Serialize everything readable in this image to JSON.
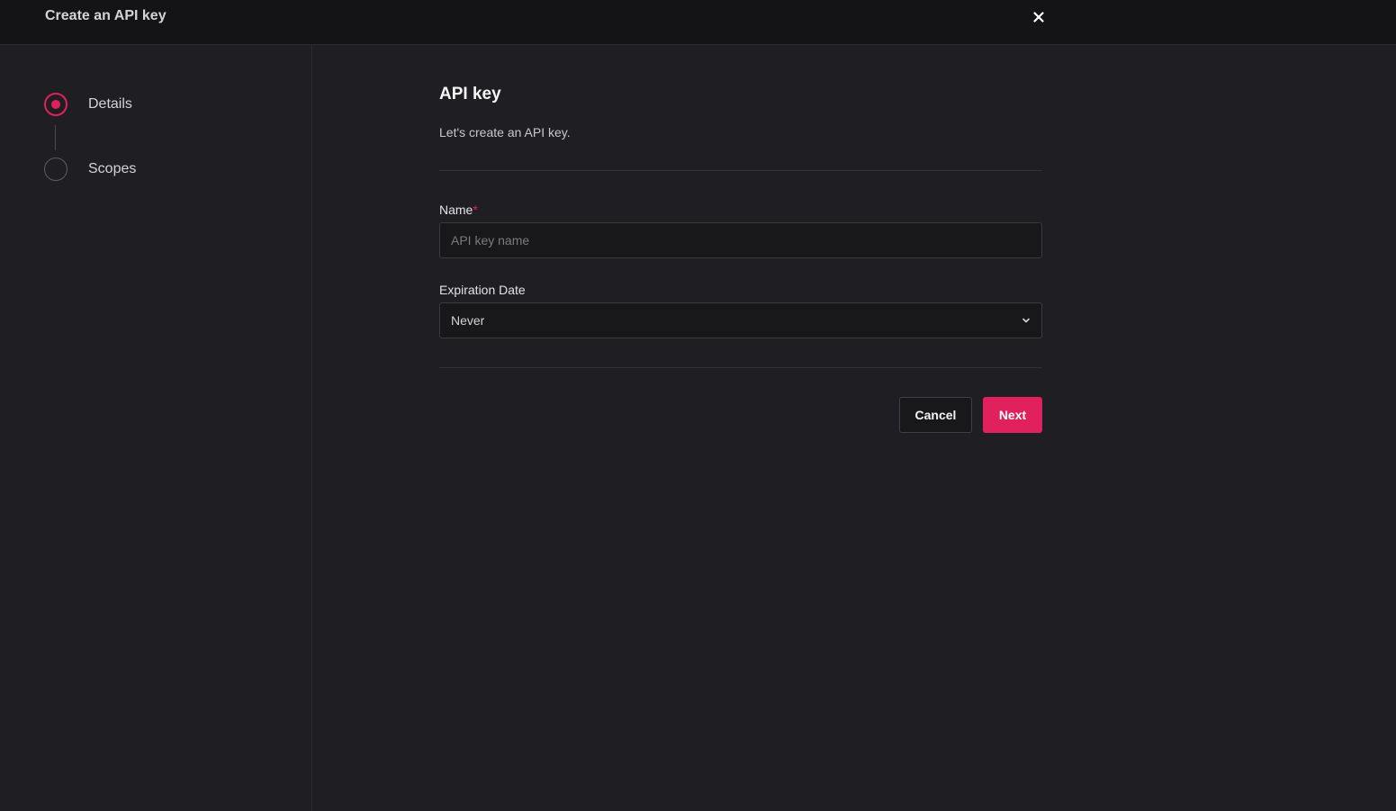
{
  "window": {
    "title": "Create an API key",
    "close_icon": "close-icon"
  },
  "steps": [
    {
      "label": "Details",
      "active": true
    },
    {
      "label": "Scopes",
      "active": false
    }
  ],
  "form": {
    "heading": "API key",
    "description": "Let's create an API key.",
    "name": {
      "label": "Name",
      "required_marker": "*",
      "placeholder": "API key name",
      "value": ""
    },
    "expiration": {
      "label": "Expiration Date",
      "selected": "Never",
      "icon": "chevron-down-icon"
    }
  },
  "actions": {
    "cancel_label": "Cancel",
    "next_label": "Next"
  },
  "colors": {
    "accent": "#e0215e",
    "background": "#1f1f23",
    "topbar": "#141417"
  }
}
